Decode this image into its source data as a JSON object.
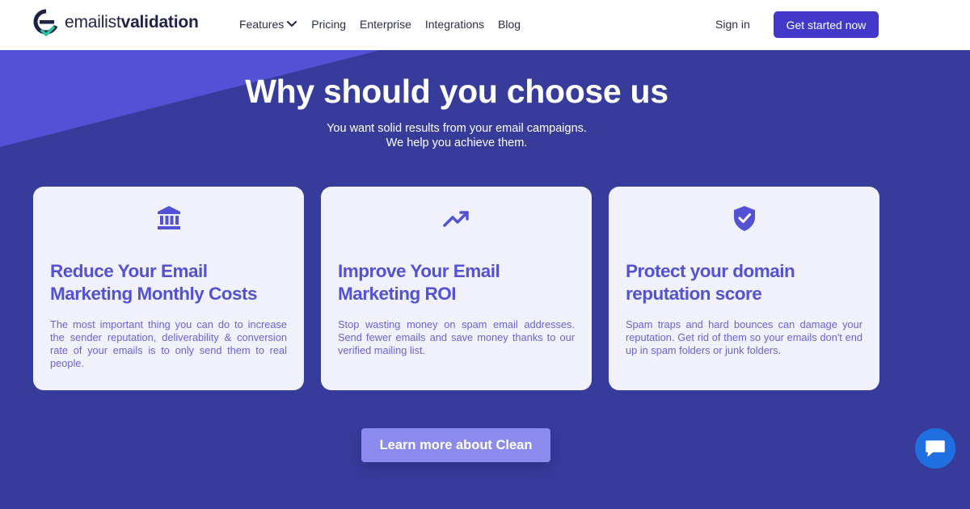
{
  "header": {
    "logo_text_light": "emailist",
    "logo_text_bold": "validation",
    "nav": [
      {
        "label": "Features",
        "has_dropdown": true
      },
      {
        "label": "Pricing"
      },
      {
        "label": "Enterprise"
      },
      {
        "label": "Integrations"
      },
      {
        "label": "Blog"
      }
    ],
    "signin_label": "Sign in",
    "cta_label": "Get started now"
  },
  "hero": {
    "title": "Why should you choose us",
    "subtitle_line1": "You want solid results from your email campaigns.",
    "subtitle_line2": "We help you achieve them."
  },
  "cards": [
    {
      "icon": "bank-icon",
      "title": "Reduce Your Email Marketing Monthly Costs",
      "text": "The most important thing you can do to increase the sender reputation, deliverability & conversion rate of your emails is to only send them to real people."
    },
    {
      "icon": "trending-up-icon",
      "title": "Improve Your Email Marketing ROI",
      "text": "Stop wasting money on spam email addresses. Send fewer emails and save money thanks to our verified mailing list."
    },
    {
      "icon": "shield-check-icon",
      "title": "Protect your domain reputation score",
      "text": "Spam traps and hard bounces can damage your reputation. Get rid of them so your emails don't end up in spam folders or junk folders."
    }
  ],
  "learn_more_label": "Learn more about Clean",
  "colors": {
    "brand": "#4338ca",
    "section_bg": "#373c9b",
    "card_bg": "#f1f1fc",
    "accent_text": "#5351d4",
    "chat": "#1f6fe0"
  }
}
